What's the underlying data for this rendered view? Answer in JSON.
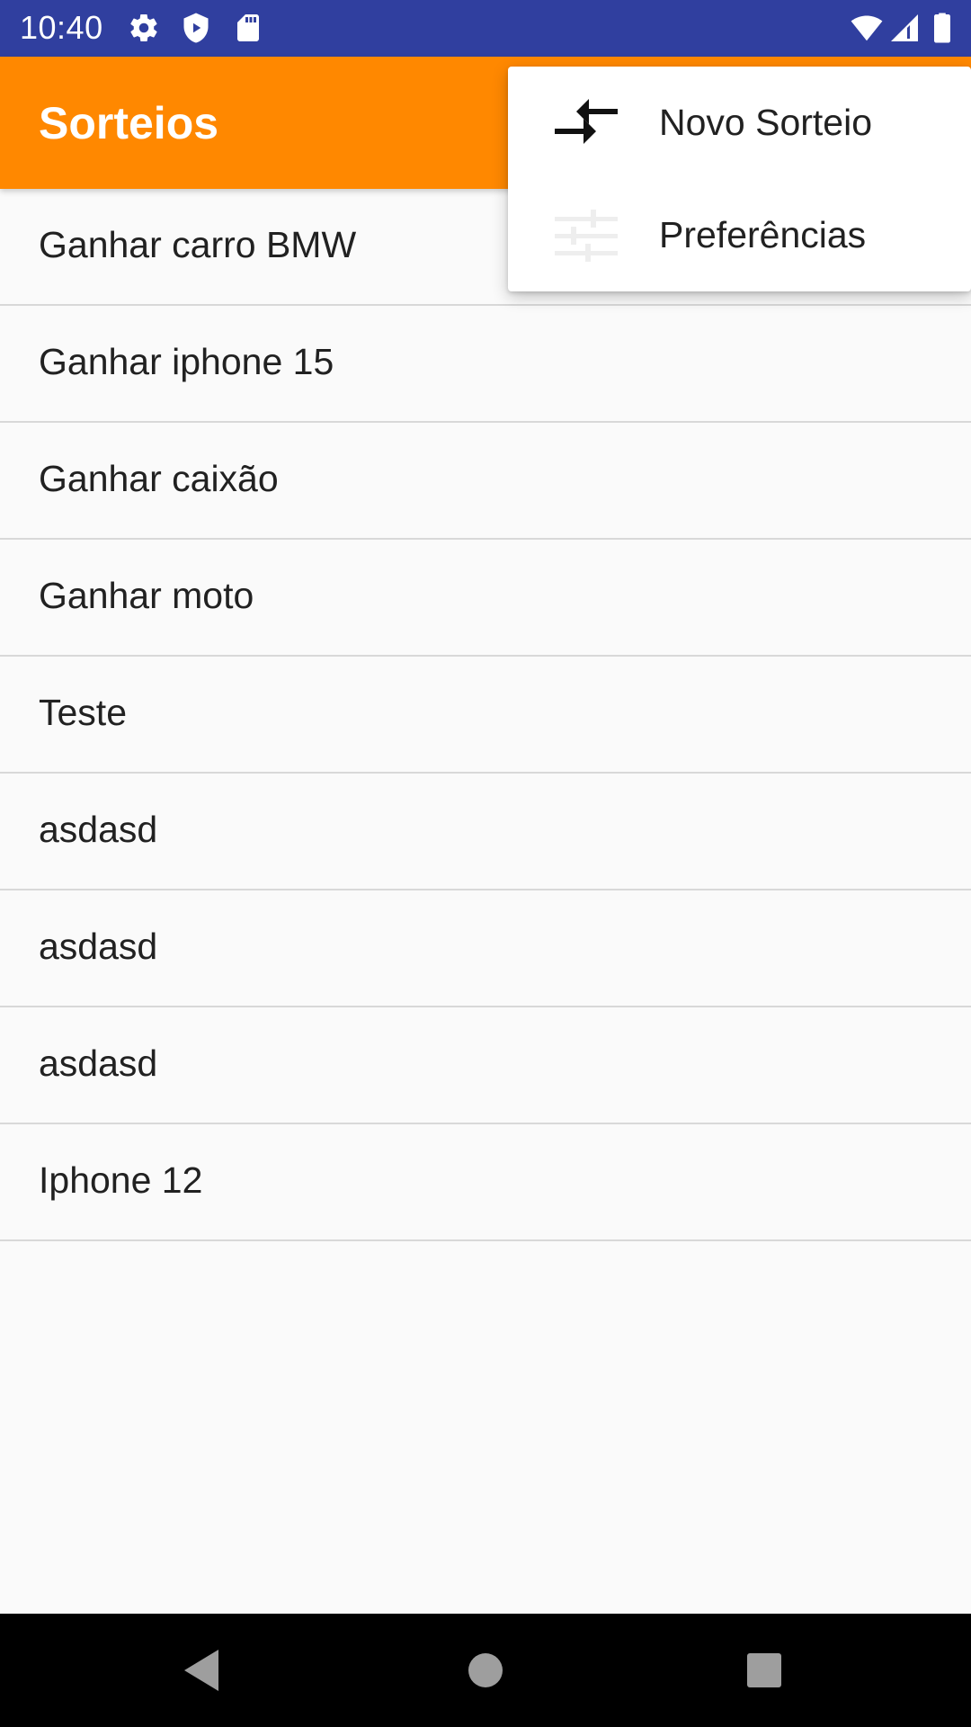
{
  "status_bar": {
    "time": "10:40",
    "icons": [
      "gear-icon",
      "shield-icon",
      "sd-card-icon",
      "wifi-icon",
      "signal-icon",
      "battery-icon"
    ],
    "background": "#303f9f"
  },
  "app_bar": {
    "title": "Sorteios",
    "background": "#ff8800"
  },
  "list": {
    "items": [
      {
        "label": "Ganhar carro BMW"
      },
      {
        "label": "Ganhar iphone 15"
      },
      {
        "label": "Ganhar caixão"
      },
      {
        "label": "Ganhar moto"
      },
      {
        "label": "Teste"
      },
      {
        "label": "asdasd"
      },
      {
        "label": "asdasd"
      },
      {
        "label": "asdasd"
      },
      {
        "label": "Iphone 12"
      }
    ]
  },
  "overflow_menu": {
    "items": [
      {
        "label": "Novo Sorteio",
        "icon": "swap-arrows-icon"
      },
      {
        "label": "Preferências",
        "icon": "sliders-icon"
      }
    ]
  },
  "nav_bar": {
    "buttons": [
      "back-icon",
      "home-icon",
      "recents-icon"
    ]
  }
}
